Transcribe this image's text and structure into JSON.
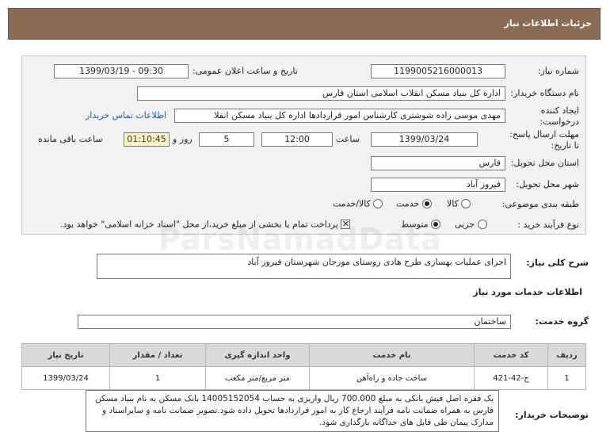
{
  "header": {
    "title": "جزئیات اطلاعات نیاز"
  },
  "form": {
    "need_number_label": "شماره نیاز:",
    "need_number": "1199005216000013",
    "announce_label": "تاریخ و ساعت اعلان عمومی:",
    "announce_value": "1399/03/19 - 09:30",
    "buyer_label": "نام دستگاه خریدار:",
    "buyer_value": "اداره کل بنیاد مسکن انقلاب اسلامی استان فارس",
    "creator_label_1": "ایجاد کننده",
    "creator_label_2": "درخواست:",
    "creator_value": "مهدی موسی زاده شوشتری کارشناس امور قراردادها اداره کل بنیاد مسکن انقلا",
    "contact_link": "اطلاعات تماس خریدار",
    "deadline_label_1": "مهلت ارسال پاسخ:",
    "deadline_label_2": "تا تاریخ:",
    "deadline_date": "1399/03/24",
    "time_label": "ساعت",
    "deadline_time": "12:00",
    "days_value": "5",
    "days_label": "روز و",
    "remaining_time": "01:10:45",
    "remaining_label": "ساعت باقی مانده",
    "province_label": "استان محل تحویل:",
    "province_value": "فارس",
    "city_label": "شهر محل تحویل:",
    "city_value": "فیروز آباد",
    "category_label": "طبقه بندی موضوعی:",
    "category_options": [
      "کالا",
      "خدمت",
      "کالا/خدمت"
    ],
    "category_selected": "خدمت",
    "process_label": "نوع فرآیند خرید :",
    "process_options": [
      "جزیی",
      "متوسط"
    ],
    "process_selected": "متوسط",
    "payment_note": "پرداخت تمام یا بخشی از مبلغ خرید،از محل \"اسناد خزانه اسلامی\" خواهد بود."
  },
  "need_summary": {
    "label": "شرح کلی نیاز:",
    "value": "اجرای عملیات بهسازی طرح هادی روستای مورجان شهرستان فیروز آباد"
  },
  "services": {
    "section_title": "اطلاعات خدمات مورد نیاز",
    "group_label": "گروه خدمت:",
    "group_value": "ساختمان",
    "columns": [
      "ردیف",
      "کد خدمت",
      "نام خدمت",
      "واحد اندازه گیری",
      "تعداد / مقدار",
      "تاریخ نیاز"
    ],
    "rows": [
      {
        "index": "1",
        "code": "ج-42-421",
        "name": "ساخت جاده و راه‌آهن",
        "unit": "متر مربع/متر مکعب",
        "qty": "1",
        "date": "1399/03/24"
      }
    ]
  },
  "buyer_notes": {
    "label": "توضیحات خریدار:",
    "text": "یک فقره اصل فیش بانکی به مبلغ 700.000 ریال واریزی به حساب 14005152054 بانک مسکن به نام بنیاد مسکن فارس به همراه ضمانت نامه فرآیند ارجاع کار به امور قراردادها تحویل داده شود.تصویر ضمانت نامه و سایراسناد و مدارک پیمان طی فایل های جداگانه بارگذاری شود."
  },
  "watermark": "ParsNamadData"
}
